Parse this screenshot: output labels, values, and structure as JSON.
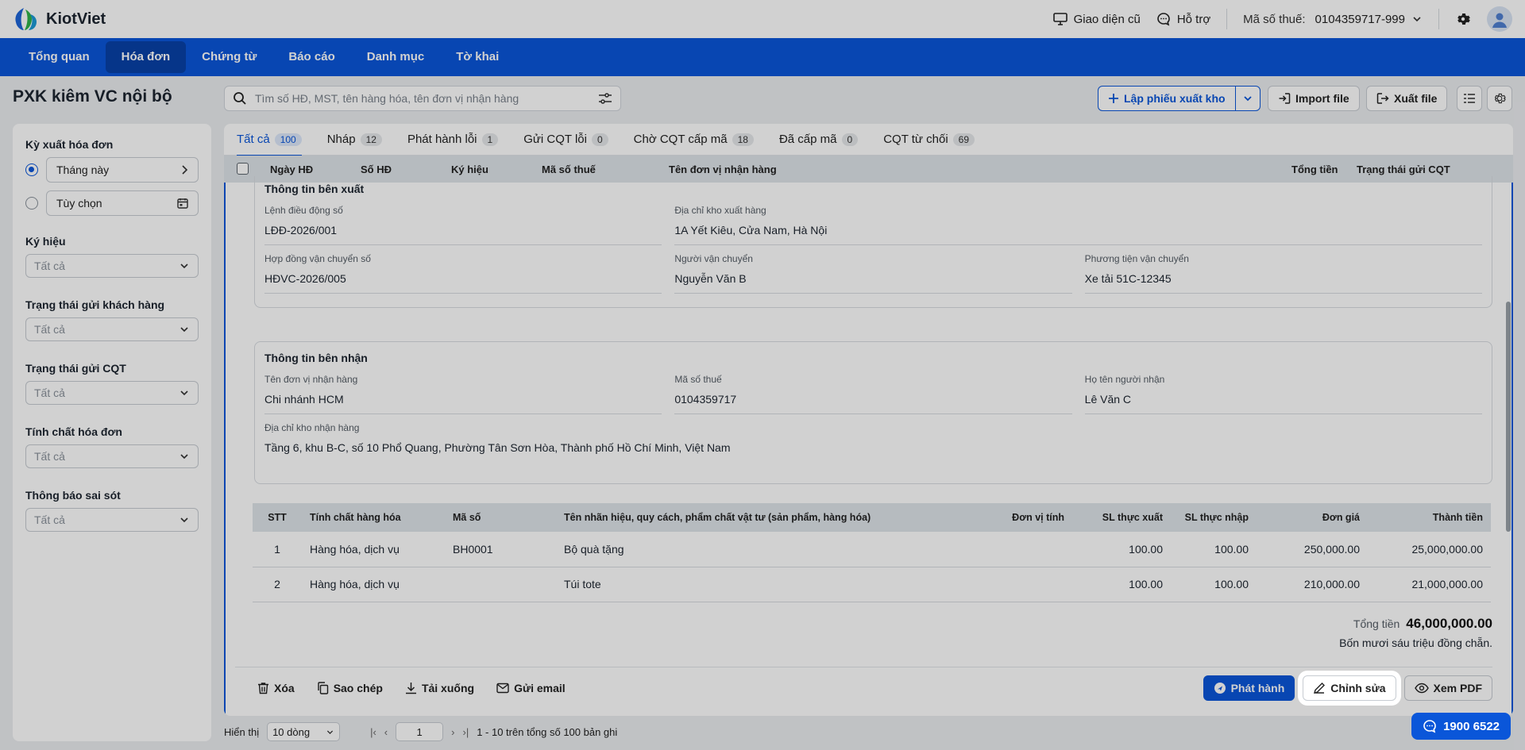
{
  "app": {
    "name": "KiotViet"
  },
  "topbar": {
    "old_ui": "Giao diện cũ",
    "support": "Hỗ trợ",
    "tax_label": "Mã số thuế:",
    "tax_value": "0104359717-999"
  },
  "nav": [
    "Tổng quan",
    "Hóa đơn",
    "Chứng từ",
    "Báo cáo",
    "Danh mục",
    "Tờ khai"
  ],
  "page": {
    "title": "PXK kiêm VC nội bộ",
    "search_placeholder": "Tìm số HĐ, MST, tên hàng hóa, tên đơn vị nhận hàng",
    "btn_create": "Lập phiếu xuất kho",
    "btn_import": "Import file",
    "btn_export": "Xuất file"
  },
  "sidebar": {
    "period_label": "Kỳ xuất hóa đơn",
    "opt_this_month": "Tháng này",
    "opt_custom": "Tùy chọn",
    "filters": [
      {
        "label": "Ký hiệu",
        "value": "Tất cả"
      },
      {
        "label": "Trạng thái gửi khách hàng",
        "value": "Tất cả"
      },
      {
        "label": "Trạng thái gửi CQT",
        "value": "Tất cả"
      },
      {
        "label": "Tính chất hóa đơn",
        "value": "Tất cả"
      },
      {
        "label": "Thông báo sai sót",
        "value": "Tất cả"
      }
    ]
  },
  "tabs": [
    {
      "label": "Tất cả",
      "count": "100"
    },
    {
      "label": "Nháp",
      "count": "12"
    },
    {
      "label": "Phát hành lỗi",
      "count": "1"
    },
    {
      "label": "Gửi CQT lỗi",
      "count": "0"
    },
    {
      "label": "Chờ CQT cấp mã",
      "count": "18"
    },
    {
      "label": "Đã cấp mã",
      "count": "0"
    },
    {
      "label": "CQT từ chối",
      "count": "69"
    }
  ],
  "columns": {
    "date": "Ngày HĐ",
    "number": "Số HĐ",
    "symbol": "Ký hiệu",
    "tax": "Mã số thuế",
    "receiver": "Tên đơn vị nhận hàng",
    "total": "Tổng tiền",
    "cqt_status": "Trạng thái gửi CQT"
  },
  "sender": {
    "title": "Thông tin bên xuất",
    "order_label": "Lệnh điều động số",
    "order_value": "LĐĐ-2026/001",
    "warehouse_label": "Địa chỉ kho xuất hàng",
    "warehouse_value": "1A Yết Kiêu, Cửa Nam, Hà Nội",
    "contract_label": "Hợp đồng vận chuyển số",
    "contract_value": "HĐVC-2026/005",
    "carrier_label": "Người vận chuyển",
    "carrier_value": "Nguyễn Văn B",
    "vehicle_label": "Phương tiện vận chuyển",
    "vehicle_value": "Xe tải 51C-12345"
  },
  "receiver": {
    "title": "Thông tin bên nhận",
    "unit_label": "Tên đơn vị nhận hàng",
    "unit_value": "Chi nhánh HCM",
    "tax_label": "Mã số thuế",
    "tax_value": "0104359717",
    "person_label": "Họ tên người nhận",
    "person_value": "Lê Văn C",
    "address_label": "Địa chỉ kho nhận hàng",
    "address_value": "Tầng 6, khu B-C, số 10 Phổ Quang, Phường Tân Sơn Hòa, Thành phố Hồ Chí Minh, Việt Nam"
  },
  "items": {
    "headers": [
      "STT",
      "Tính chất hàng hóa",
      "Mã số",
      "Tên nhãn hiệu, quy cách, phẩm chất vật tư (sản phẩm, hàng hóa)",
      "Đơn vị tính",
      "SL thực xuất",
      "SL thực nhập",
      "Đơn giá",
      "Thành tiền"
    ],
    "rows": [
      [
        "1",
        "Hàng hóa, dịch vụ",
        "BH0001",
        "Bộ quà tặng",
        "",
        "100.00",
        "100.00",
        "250,000.00",
        "25,000,000.00"
      ],
      [
        "2",
        "Hàng hóa, dịch vụ",
        "",
        "Túi tote",
        "",
        "100.00",
        "100.00",
        "210,000.00",
        "21,000,000.00"
      ]
    ]
  },
  "summary": {
    "total_label": "Tổng tiền",
    "total_value": "46,000,000.00",
    "in_words": "Bốn mươi sáu triệu đồng chẵn."
  },
  "actions": {
    "delete": "Xóa",
    "copy": "Sao chép",
    "download": "Tải xuống",
    "email": "Gửi email",
    "publish": "Phát hành",
    "edit": "Chỉnh sửa",
    "pdf": "Xem PDF"
  },
  "footer": {
    "show_label": "Hiển thị",
    "page_size": "10 dòng",
    "page": "1",
    "range": "1 - 10 trên tổng số 100 bản ghi"
  },
  "hotline": "1900 6522",
  "colors": {
    "primary": "#0a56d9",
    "nav_active": "#0841a8"
  }
}
